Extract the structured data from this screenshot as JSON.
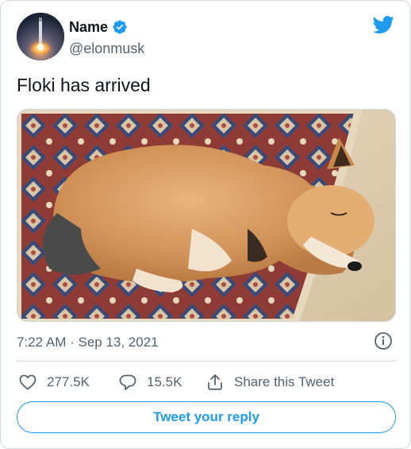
{
  "tweet": {
    "author_name": "Name",
    "author_handle": "@elonmusk",
    "text": "Floki has arrived",
    "timestamp": "7:22 AM · Sep 13, 2021"
  },
  "actions": {
    "likes": "277.5K",
    "replies": "15.5K",
    "share_label": "Share this Tweet"
  },
  "reply_button_label": "Tweet your reply",
  "colors": {
    "accent": "#1d9bf0",
    "muted_text": "#536471",
    "border": "#cfd9de"
  },
  "icons": [
    "avatar-image",
    "verified-badge-icon",
    "twitter-bird-icon",
    "info-icon",
    "heart-icon",
    "reply-bubble-icon",
    "share-icon"
  ]
}
